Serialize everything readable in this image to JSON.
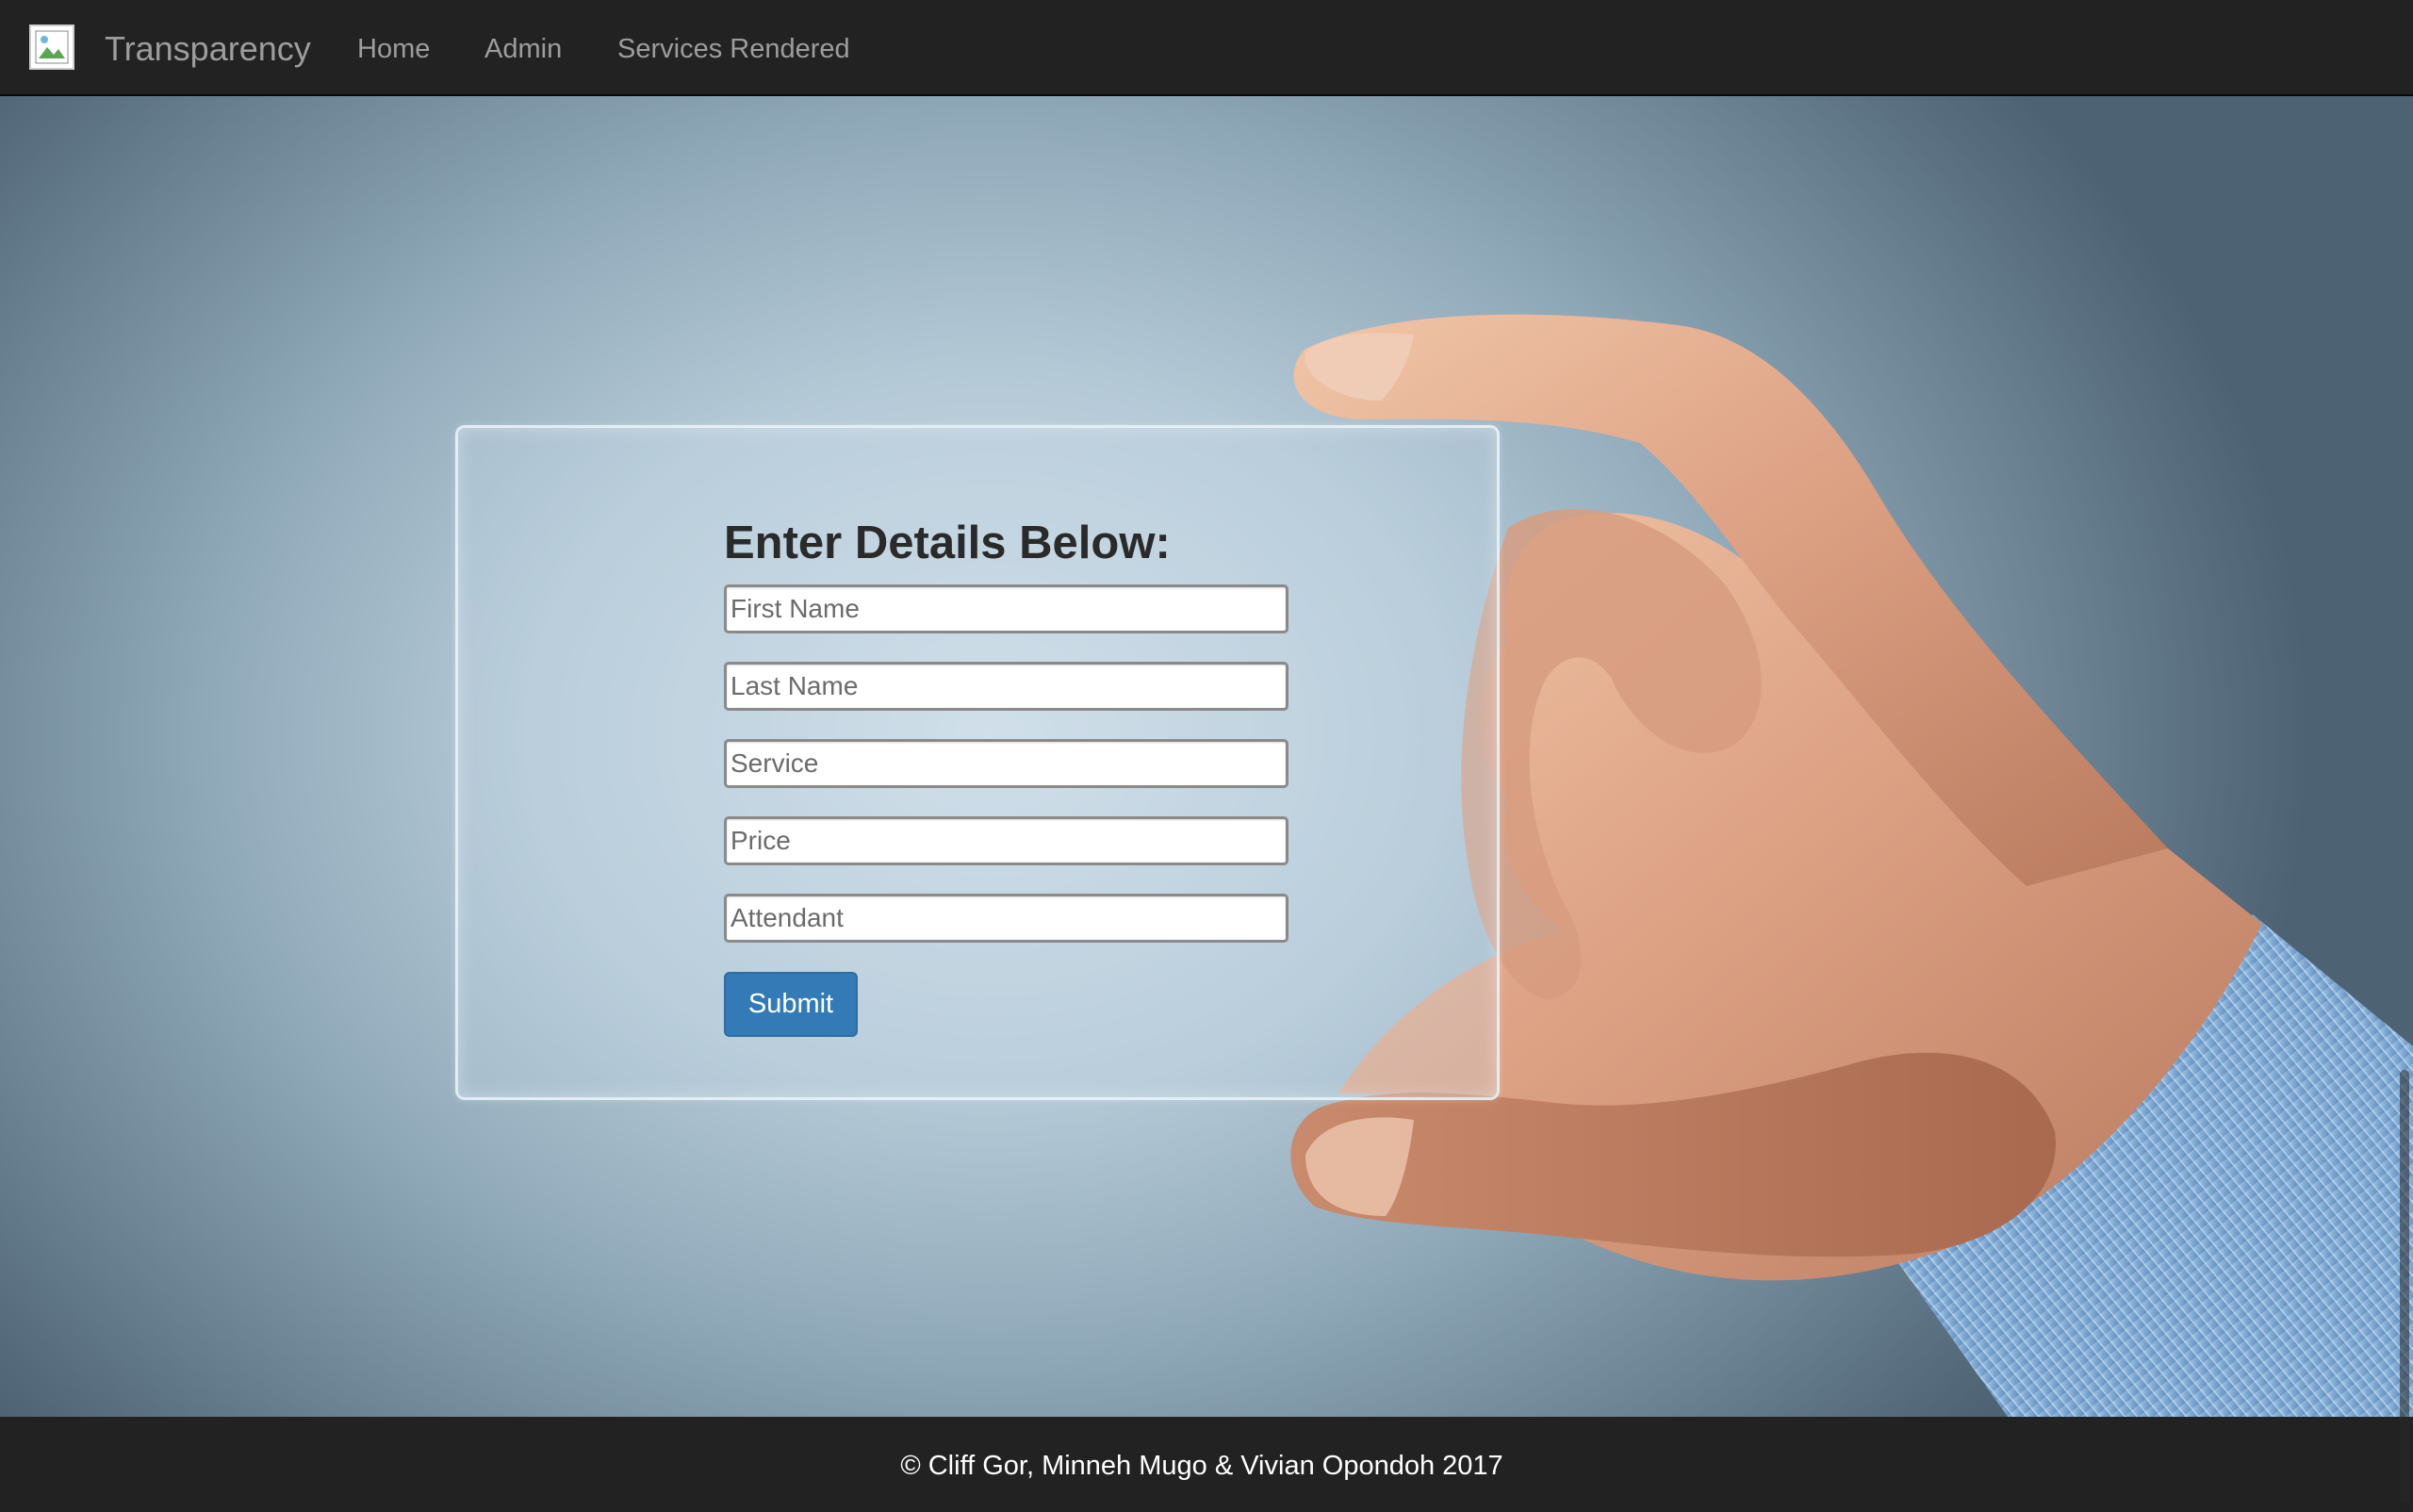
{
  "navbar": {
    "brand": "Transparency",
    "brand_icon": "broken-image-icon",
    "links": [
      "Home",
      "Admin",
      "Services Rendered"
    ]
  },
  "form": {
    "title": "Enter Details Below:",
    "fields": {
      "first_name": "First Name",
      "last_name": "Last Name",
      "service": "Service",
      "price": "Price",
      "attendant": "Attendant"
    },
    "submit_label": "Submit"
  },
  "footer": {
    "copyright": "© Cliff Gor, Minneh Mugo & Vivian Opondoh 2017"
  },
  "colors": {
    "navbar_bg": "#222222",
    "nav_link": "#9d9d9d",
    "button_primary": "#337ab7"
  }
}
